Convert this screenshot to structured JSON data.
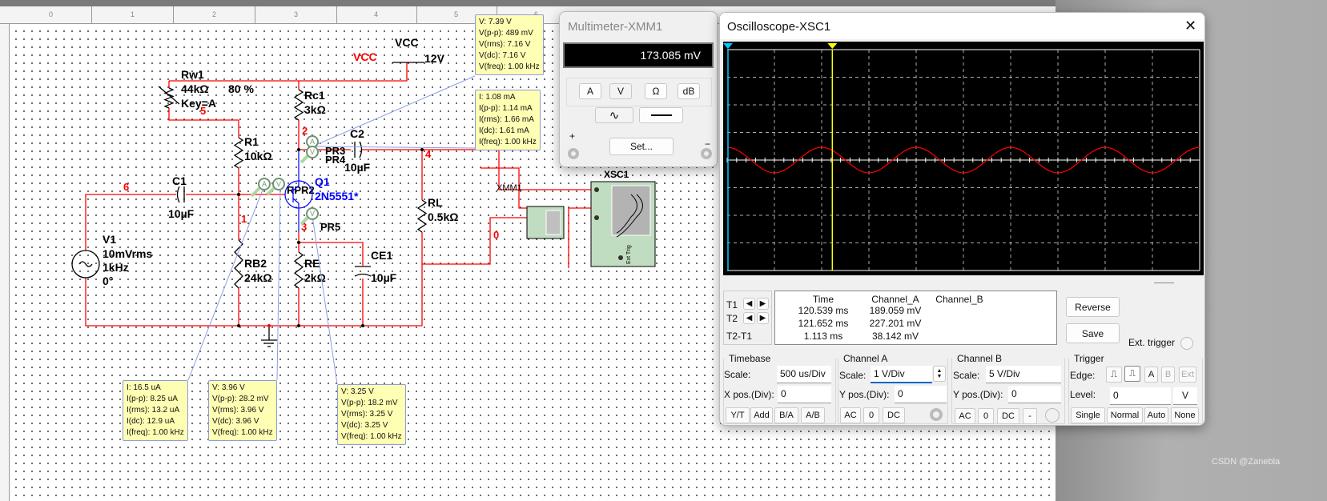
{
  "ruler": {
    "columns": [
      "0",
      "1",
      "2",
      "3",
      "4",
      "5",
      "6"
    ]
  },
  "schematic": {
    "vcc_symbol": "VCC",
    "vcc_value": "12V",
    "vcc_net": "VCC",
    "rw1": {
      "name": "Rw1",
      "value": "44kΩ",
      "percent": "80 %",
      "key": "Key=A"
    },
    "rc1": {
      "name": "Rc1",
      "value": "3kΩ"
    },
    "r1": {
      "name": "R1",
      "value": "10kΩ"
    },
    "rb2": {
      "name": "RB2",
      "value": "24kΩ"
    },
    "re": {
      "name": "RE",
      "value": "2kΩ"
    },
    "rl": {
      "name": "RL",
      "value": "0.5kΩ"
    },
    "c1": {
      "name": "C1",
      "value": "10µF"
    },
    "c2": {
      "name": "C2",
      "value": "10µF"
    },
    "ce1": {
      "name": "CE1",
      "value": "10µF"
    },
    "v1": {
      "name": "V1",
      "amplitude": "10mVrms",
      "frequency": "1kHz",
      "phase": "0°"
    },
    "q1": {
      "name": "Q1",
      "model": "2N5551*"
    },
    "probe_labels": {
      "pr1pr2": "RPR2",
      "pr3": "PR3",
      "pr4": "PR4",
      "pr5": "PR5"
    },
    "nets": {
      "n1": "1",
      "n2": "2",
      "n3": "3",
      "n4": "4",
      "n5": "5",
      "n6": "6",
      "n0": "0"
    },
    "xmm1_label": "XMM1",
    "xsc1_label": "XSC1",
    "ext_trig": "Ext Trig",
    "wire_color": "#ff0000",
    "transistor_color": "#0000ff"
  },
  "probes": [
    {
      "lines": [
        "V: 7.39 V",
        "V(p-p): 489 mV",
        "V(rms): 7.16 V",
        "V(dc): 7.16 V",
        "V(freq): 1.00 kHz"
      ]
    },
    {
      "lines": [
        "I: 1.08 mA",
        "I(p-p): 1.14 mA",
        "I(rms): 1.66 mA",
        "I(dc): 1.61 mA",
        "I(freq): 1.00 kHz"
      ]
    },
    {
      "lines": [
        "I: 16.5 uA",
        "I(p-p): 8.25 uA",
        "I(rms): 13.2 uA",
        "I(dc): 12.9 uA",
        "I(freq): 1.00 kHz"
      ]
    },
    {
      "lines": [
        "V: 3.96 V",
        "V(p-p): 28.2 mV",
        "V(rms): 3.96 V",
        "V(dc): 3.96 V",
        "V(freq): 1.00 kHz"
      ]
    },
    {
      "lines": [
        "V: 3.25 V",
        "V(p-p): 18.2 mV",
        "V(rms): 3.25 V",
        "V(dc): 3.25 V",
        "V(freq): 1.00 kHz"
      ]
    }
  ],
  "multimeter": {
    "title": "Multimeter-XMM1",
    "reading": "173.085 mV",
    "modes": [
      "A",
      "V",
      "Ω",
      "dB"
    ],
    "plus": "+",
    "minus": "−",
    "set_label": "Set...",
    "selected_mode": "V",
    "selected_signal": "ac"
  },
  "oscilloscope": {
    "title": "Oscilloscope-XSC1",
    "trace_color": "#ff0000",
    "cursor1_color": "#00c8ff",
    "cursor2_color": "#ffff00",
    "signal": {
      "frequency_khz": 1,
      "amplitude_v": 0.23
    },
    "cursors": {
      "t1": "T1",
      "t2": "T2",
      "t2t1": "T2-T1"
    },
    "readout": {
      "headers": [
        "Time",
        "Channel_A",
        "Channel_B"
      ],
      "rows": [
        [
          "120.539 ms",
          "189.059 mV",
          ""
        ],
        [
          "121.652 ms",
          "227.201 mV",
          ""
        ],
        [
          "1.113 ms",
          "38.142 mV",
          ""
        ]
      ]
    },
    "reverse": "Reverse",
    "save": "Save",
    "ext_trigger": "Ext. trigger",
    "timebase": {
      "title": "Timebase",
      "scale_label": "Scale:",
      "scale": "500 us/Div",
      "xpos_label": "X pos.(Div):",
      "xpos": "0",
      "buttons": [
        "Y/T",
        "Add",
        "B/A",
        "A/B"
      ]
    },
    "channel_a": {
      "title": "Channel A",
      "scale_label": "Scale:",
      "scale": "1  V/Div",
      "ypos_label": "Y pos.(Div):",
      "ypos": "0",
      "buttons": [
        "AC",
        "0",
        "DC"
      ]
    },
    "channel_b": {
      "title": "Channel B",
      "scale_label": "Scale:",
      "scale": "5  V/Div",
      "ypos_label": "Y pos.(Div):",
      "ypos": "0",
      "buttons": [
        "AC",
        "0",
        "DC",
        "-"
      ]
    },
    "trigger": {
      "title": "Trigger",
      "edge_label": "Edge:",
      "sources": [
        "A",
        "B",
        "Ext"
      ],
      "level_label": "Level:",
      "level": "0",
      "level_unit": "V",
      "modes": [
        "Single",
        "Normal",
        "Auto",
        "None"
      ]
    }
  },
  "watermark": "CSDN @Zanebla"
}
